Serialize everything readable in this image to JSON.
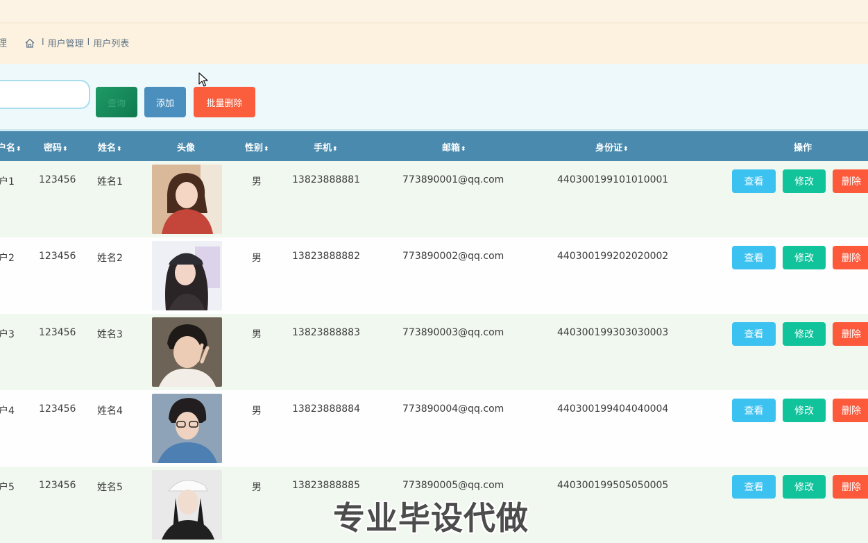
{
  "header": {
    "section_cut": "理"
  },
  "breadcrumb": {
    "separator": "l",
    "items": [
      "用户管理",
      "用户列表"
    ]
  },
  "toolbar": {
    "search_value": "",
    "query_label": "查询",
    "add_label": "添加",
    "bulk_delete_label": "批量删除"
  },
  "table": {
    "columns": [
      "户名",
      "密码",
      "姓名",
      "头像",
      "性别",
      "手机",
      "邮箱",
      "身份证",
      "操作"
    ],
    "sort_icon": "⬍",
    "rows": [
      {
        "username": "户1",
        "password": "123456",
        "name": "姓名1",
        "gender": "男",
        "phone": "13823888881",
        "email": "773890001@qq.com",
        "id_card": "440300199101010001"
      },
      {
        "username": "户2",
        "password": "123456",
        "name": "姓名2",
        "gender": "男",
        "phone": "13823888882",
        "email": "773890002@qq.com",
        "id_card": "440300199202020002"
      },
      {
        "username": "户3",
        "password": "123456",
        "name": "姓名3",
        "gender": "男",
        "phone": "13823888883",
        "email": "773890003@qq.com",
        "id_card": "440300199303030003"
      },
      {
        "username": "户4",
        "password": "123456",
        "name": "姓名4",
        "gender": "男",
        "phone": "13823888884",
        "email": "773890004@qq.com",
        "id_card": "440300199404040004"
      },
      {
        "username": "户5",
        "password": "123456",
        "name": "姓名5",
        "gender": "男",
        "phone": "13823888885",
        "email": "773890005@qq.com",
        "id_card": "440300199505050005"
      }
    ],
    "actions": {
      "view": "查看",
      "edit": "修改",
      "delete": "删除"
    }
  },
  "watermark": "专业毕设代做",
  "colors": {
    "header_bg": "#4a8aae",
    "view": "#3cc2f0",
    "edit": "#10c39b",
    "delete": "#fd5a3c",
    "add": "#4a8fbd",
    "query": "#1f9a66"
  }
}
